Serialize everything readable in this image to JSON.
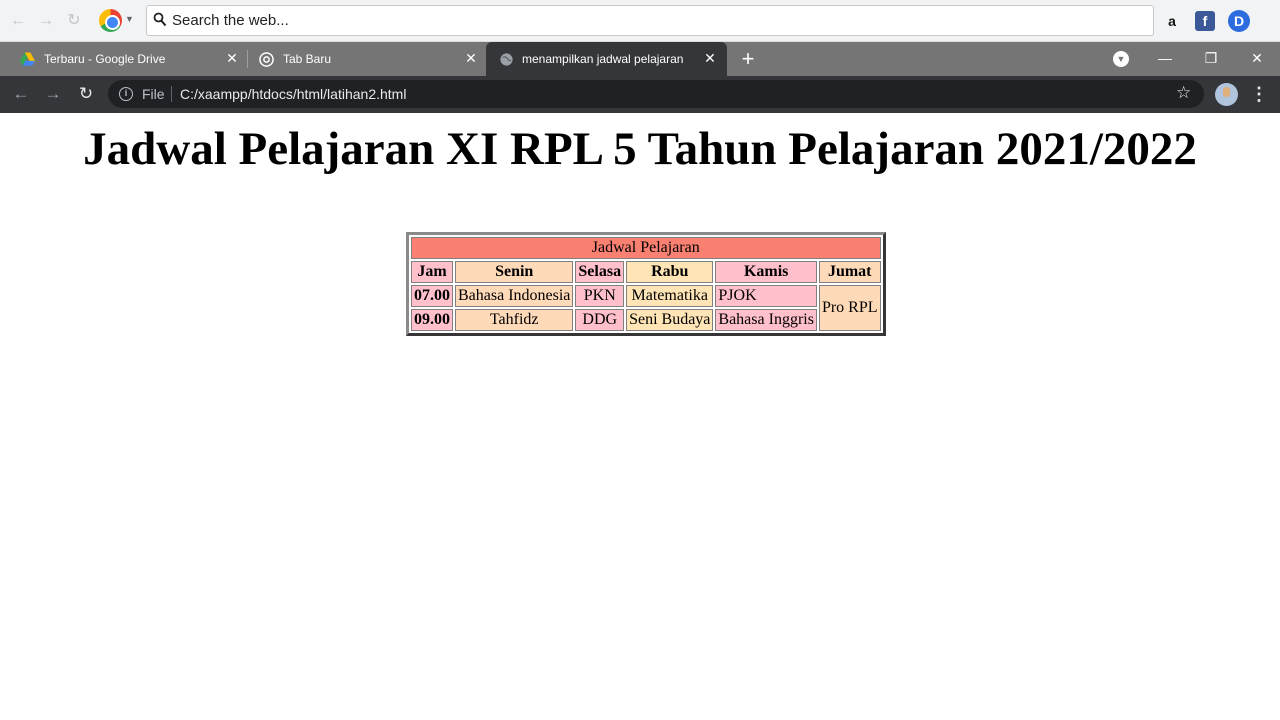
{
  "search_strip": {
    "placeholder": "Search the web..."
  },
  "extensions": {
    "amazon": "a",
    "facebook": "f",
    "d": "D"
  },
  "tabs": [
    {
      "label": "Terbaru - Google Drive",
      "icon": "google-drive-icon"
    },
    {
      "label": "Tab Baru",
      "icon": "chrome-icon"
    },
    {
      "label": "menampilkan jadwal pelajaran",
      "icon": "globe-icon"
    }
  ],
  "address_bar": {
    "scheme_label": "File",
    "url": "C:/xaampp/htdocs/html/latihan2.html"
  },
  "page": {
    "heading": "Jadwal Pelajaran XI RPL 5 Tahun Pelajaran 2021/2022",
    "table": {
      "caption": "Jadwal Pelajaran",
      "headers": [
        "Jam",
        "Senin",
        "Selasa",
        "Rabu",
        "Kamis",
        "Jumat"
      ],
      "rows": [
        {
          "jam": "07.00",
          "senin": "Bahasa Indonesia",
          "selasa": "PKN",
          "rabu": "Matematika",
          "kamis": "PJOK"
        },
        {
          "jam": "09.00",
          "senin": "Tahfidz",
          "selasa": "DDG",
          "rabu": "Seni Budaya",
          "kamis": "Bahasa Inggris"
        }
      ],
      "jumat_merged": "Pro RPL"
    }
  },
  "colors": {
    "caption_bg": "#fa8072",
    "pink": "#ffc0cb",
    "peach": "#ffdab9",
    "moccasin": "#ffe4b5",
    "tab_strip": "#757575",
    "toolbar": "#35363a"
  }
}
